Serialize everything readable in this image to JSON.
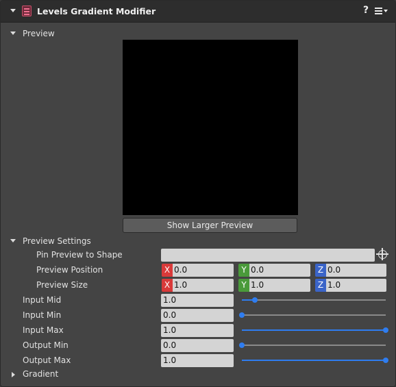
{
  "component": {
    "title": "Levels Gradient Modifier",
    "help_label": "?"
  },
  "preview": {
    "section_label": "Preview",
    "show_larger_label": "Show Larger Preview"
  },
  "preview_settings": {
    "section_label": "Preview Settings",
    "pin_label": "Pin Preview to Shape",
    "pin_value": "",
    "position_label": "Preview Position",
    "position": {
      "x": "0.0",
      "y": "0.0",
      "z": "0.0"
    },
    "size_label": "Preview Size",
    "size": {
      "x": "1.0",
      "y": "1.0",
      "z": "1.0"
    },
    "axis_labels": {
      "x": "X",
      "y": "Y",
      "z": "Z"
    }
  },
  "levels": {
    "input_mid_label": "Input Mid",
    "input_mid_value": "1.0",
    "input_mid_slider": 0.09,
    "input_min_label": "Input Min",
    "input_min_value": "0.0",
    "input_min_slider": 0.0,
    "input_max_label": "Input Max",
    "input_max_value": "1.0",
    "input_max_slider": 1.0,
    "output_min_label": "Output Min",
    "output_min_value": "0.0",
    "output_min_slider": 0.0,
    "output_max_label": "Output Max",
    "output_max_value": "1.0",
    "output_max_slider": 1.0
  },
  "gradient": {
    "section_label": "Gradient"
  },
  "colors": {
    "accent": "#2f7df0",
    "axis_x": "#d93a3a",
    "axis_y": "#4a9a3a",
    "axis_z": "#3a64c8"
  }
}
